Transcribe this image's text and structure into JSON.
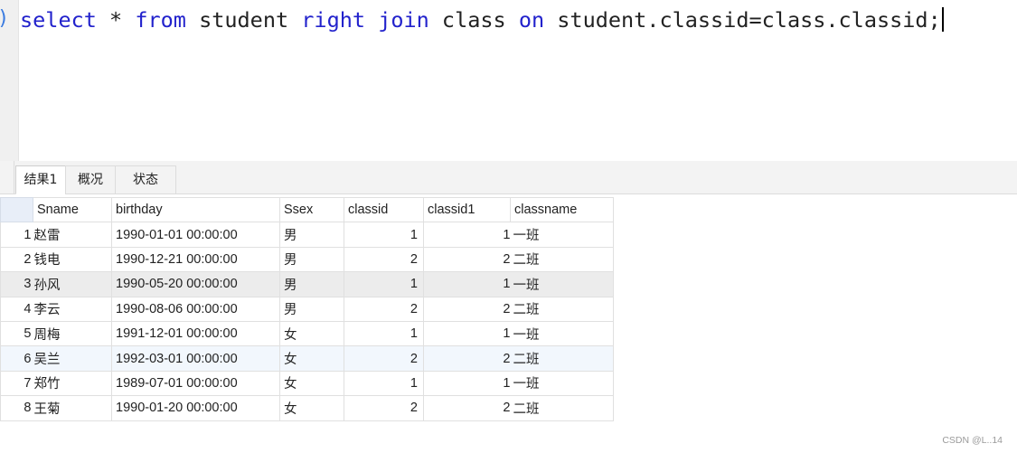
{
  "editor": {
    "gutter_mark": ")",
    "sql": {
      "t1": "select",
      "t2": " * ",
      "t3": "from",
      "t4": " student ",
      "t5": "right",
      "t6": " ",
      "t7": "join",
      "t8": " class ",
      "t9": "on",
      "t10": " student.classid=class.classid;"
    }
  },
  "result": {
    "tabs": [
      "结果1",
      "概况",
      "状态"
    ],
    "columns": [
      "Sname",
      "birthday",
      "Ssex",
      "classid",
      "classid1",
      "classname"
    ],
    "rows": [
      {
        "n": "1",
        "Sname": "赵雷",
        "birthday": "1990-01-01 00:00:00",
        "Ssex": "男",
        "classid": "1",
        "classid1": "1",
        "classname": "一班"
      },
      {
        "n": "2",
        "Sname": "钱电",
        "birthday": "1990-12-21 00:00:00",
        "Ssex": "男",
        "classid": "2",
        "classid1": "2",
        "classname": "二班"
      },
      {
        "n": "3",
        "Sname": "孙风",
        "birthday": "1990-05-20 00:00:00",
        "Ssex": "男",
        "classid": "1",
        "classid1": "1",
        "classname": "一班"
      },
      {
        "n": "4",
        "Sname": "李云",
        "birthday": "1990-08-06 00:00:00",
        "Ssex": "男",
        "classid": "2",
        "classid1": "2",
        "classname": "二班"
      },
      {
        "n": "5",
        "Sname": "周梅",
        "birthday": "1991-12-01 00:00:00",
        "Ssex": "女",
        "classid": "1",
        "classid1": "1",
        "classname": "一班"
      },
      {
        "n": "6",
        "Sname": "吴兰",
        "birthday": "1992-03-01 00:00:00",
        "Ssex": "女",
        "classid": "2",
        "classid1": "2",
        "classname": "二班"
      },
      {
        "n": "7",
        "Sname": "郑竹",
        "birthday": "1989-07-01 00:00:00",
        "Ssex": "女",
        "classid": "1",
        "classid1": "1",
        "classname": "一班"
      },
      {
        "n": "8",
        "Sname": "王菊",
        "birthday": "1990-01-20 00:00:00",
        "Ssex": "女",
        "classid": "2",
        "classid1": "2",
        "classname": "二班"
      }
    ]
  },
  "watermark": "CSDN @L..14",
  "colors": {
    "keyword": "#2222cc",
    "selected_row": "#ececec",
    "hover_row": "#f2f7fd"
  }
}
